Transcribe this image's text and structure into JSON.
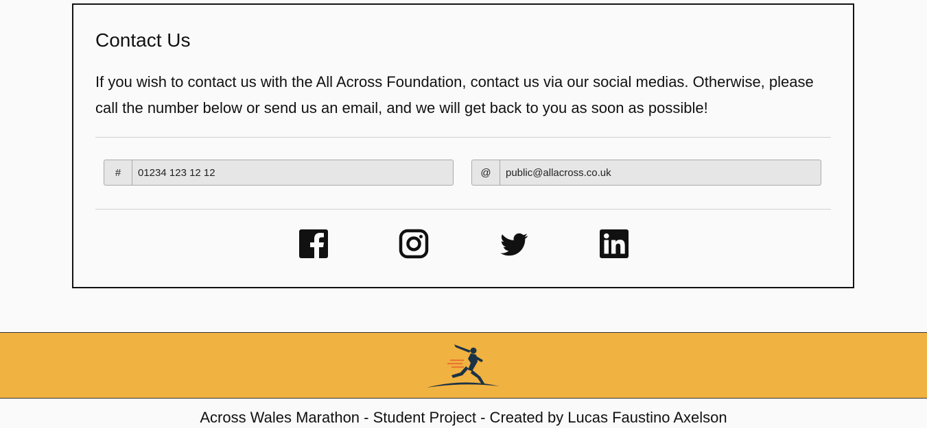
{
  "contact": {
    "title": "Contact Us",
    "text": "If you wish to contact us with the All Across Foundation, contact us via our social medias. Otherwise, please call the number below or send us an email, and we will get back to you as soon as possible!",
    "phone": {
      "addon": "#",
      "value": "01234 123 12 12"
    },
    "email": {
      "addon": "@",
      "value": "public@allacross.co.uk"
    }
  },
  "social": [
    {
      "name": "facebook-icon"
    },
    {
      "name": "instagram-icon"
    },
    {
      "name": "twitter-icon"
    },
    {
      "name": "linkedin-icon"
    }
  ],
  "footer": {
    "logo": "runner-logo",
    "band_color": "#f0b240",
    "credit": "Across Wales Marathon - Student Project - Created by Lucas Faustino Axelson"
  }
}
